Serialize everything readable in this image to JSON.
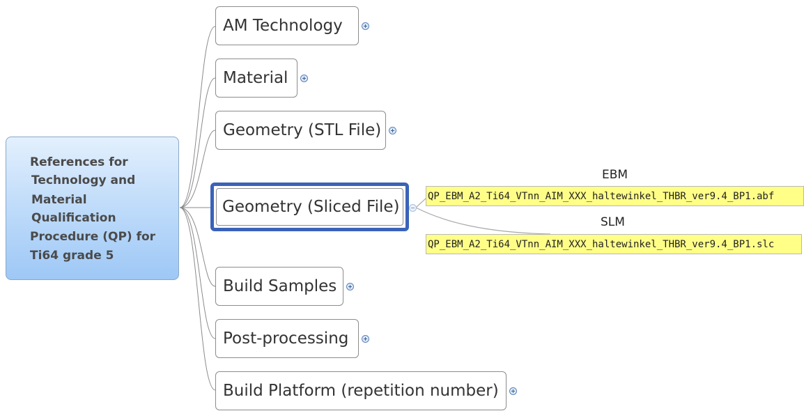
{
  "central_topic": {
    "lines": [
      "References for",
      "Technology and",
      "Material",
      "Qualification",
      "Procedure (QP) for",
      "Ti64 grade 5"
    ]
  },
  "topics": [
    {
      "label": "AM Technology",
      "collapsed": true
    },
    {
      "label": "Material",
      "collapsed": true
    },
    {
      "label": "Geometry (STL File)",
      "collapsed": true
    },
    {
      "label": "Geometry (Sliced File)",
      "selected": true,
      "expanded": true
    },
    {
      "label": "Build Samples",
      "collapsed": true
    },
    {
      "label": "Post-processing",
      "collapsed": true
    },
    {
      "label": "Build Platform (repetition number)",
      "collapsed": true
    }
  ],
  "subtopics": [
    {
      "label": "EBM",
      "file": "QP_EBM_A2_Ti64_VTnn_AIM_XXX_haltewinkel_THBR_ver9.4_BP1.abf"
    },
    {
      "label": "SLM",
      "file": "QP_EBM_A2_Ti64_VTnn_AIM_XXX_haltewinkel_THBR_ver9.4_BP1.slc"
    }
  ],
  "colors": {
    "selection_border": "#3a63b8",
    "central_fill": "#9ec8f6",
    "file_highlight": "#ffff88"
  }
}
